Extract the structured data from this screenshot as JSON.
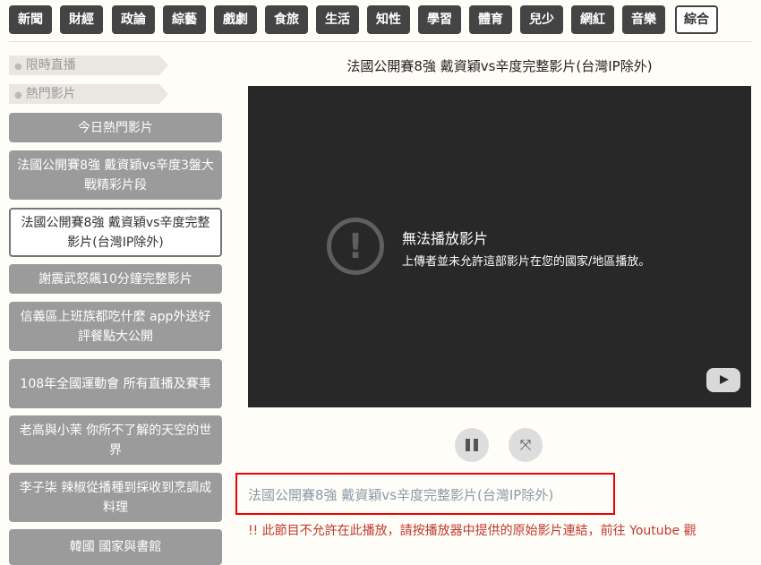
{
  "categories": [
    {
      "label": "新聞",
      "active": false
    },
    {
      "label": "財經",
      "active": false
    },
    {
      "label": "政論",
      "active": false
    },
    {
      "label": "綜藝",
      "active": false
    },
    {
      "label": "戲劇",
      "active": false
    },
    {
      "label": "食旅",
      "active": false
    },
    {
      "label": "生活",
      "active": false
    },
    {
      "label": "知性",
      "active": false
    },
    {
      "label": "學習",
      "active": false
    },
    {
      "label": "體育",
      "active": false
    },
    {
      "label": "兒少",
      "active": false
    },
    {
      "label": "網紅",
      "active": false
    },
    {
      "label": "音樂",
      "active": false
    },
    {
      "label": "綜合",
      "active": true
    }
  ],
  "sidebar": {
    "sections": [
      {
        "label": "限時直播"
      },
      {
        "label": "熱門影片"
      }
    ],
    "items": [
      {
        "label": "今日熱門影片",
        "active": false
      },
      {
        "label": "法國公開賽8強 戴資穎vs辛度3盤大戰精彩片段",
        "active": false
      },
      {
        "label": "法國公開賽8強 戴資穎vs辛度完整影片(台灣IP除外)",
        "active": true
      },
      {
        "label": "謝震武怒飆10分鐘完整影片",
        "active": false
      },
      {
        "label": "信義區上班族都吃什麼 app外送好評餐點大公開",
        "active": false
      },
      {
        "label": "108年全國運動會 所有直播及賽事",
        "active": false
      },
      {
        "label": "老高與小茉 你所不了解的天空的世界",
        "active": false
      },
      {
        "label": "李子柒 辣椒從播種到採收到烹調成料理",
        "active": false
      },
      {
        "label": "韓國 國家與書館",
        "active": false
      }
    ]
  },
  "main": {
    "title": "法國公開賽8強 戴資穎vs辛度完整影片(台灣IP除外)",
    "player": {
      "error_title": "無法播放影片",
      "error_message": "上傳者並未允許這部影片在您的國家/地區播放。",
      "error_icon": "exclamation-icon"
    },
    "video_link": "法國公開賽8強 戴資穎vs辛度完整影片(台灣IP除外)",
    "notice": "!! 此節目不允許在此播放，請按播放器中提供的原始影片連結，前往 Youtube 觀"
  },
  "colors": {
    "accent_border": "#e00000",
    "category_bg": "#444444",
    "sidebar_item_bg": "#9b9b9b",
    "notice": "#c0392b"
  }
}
